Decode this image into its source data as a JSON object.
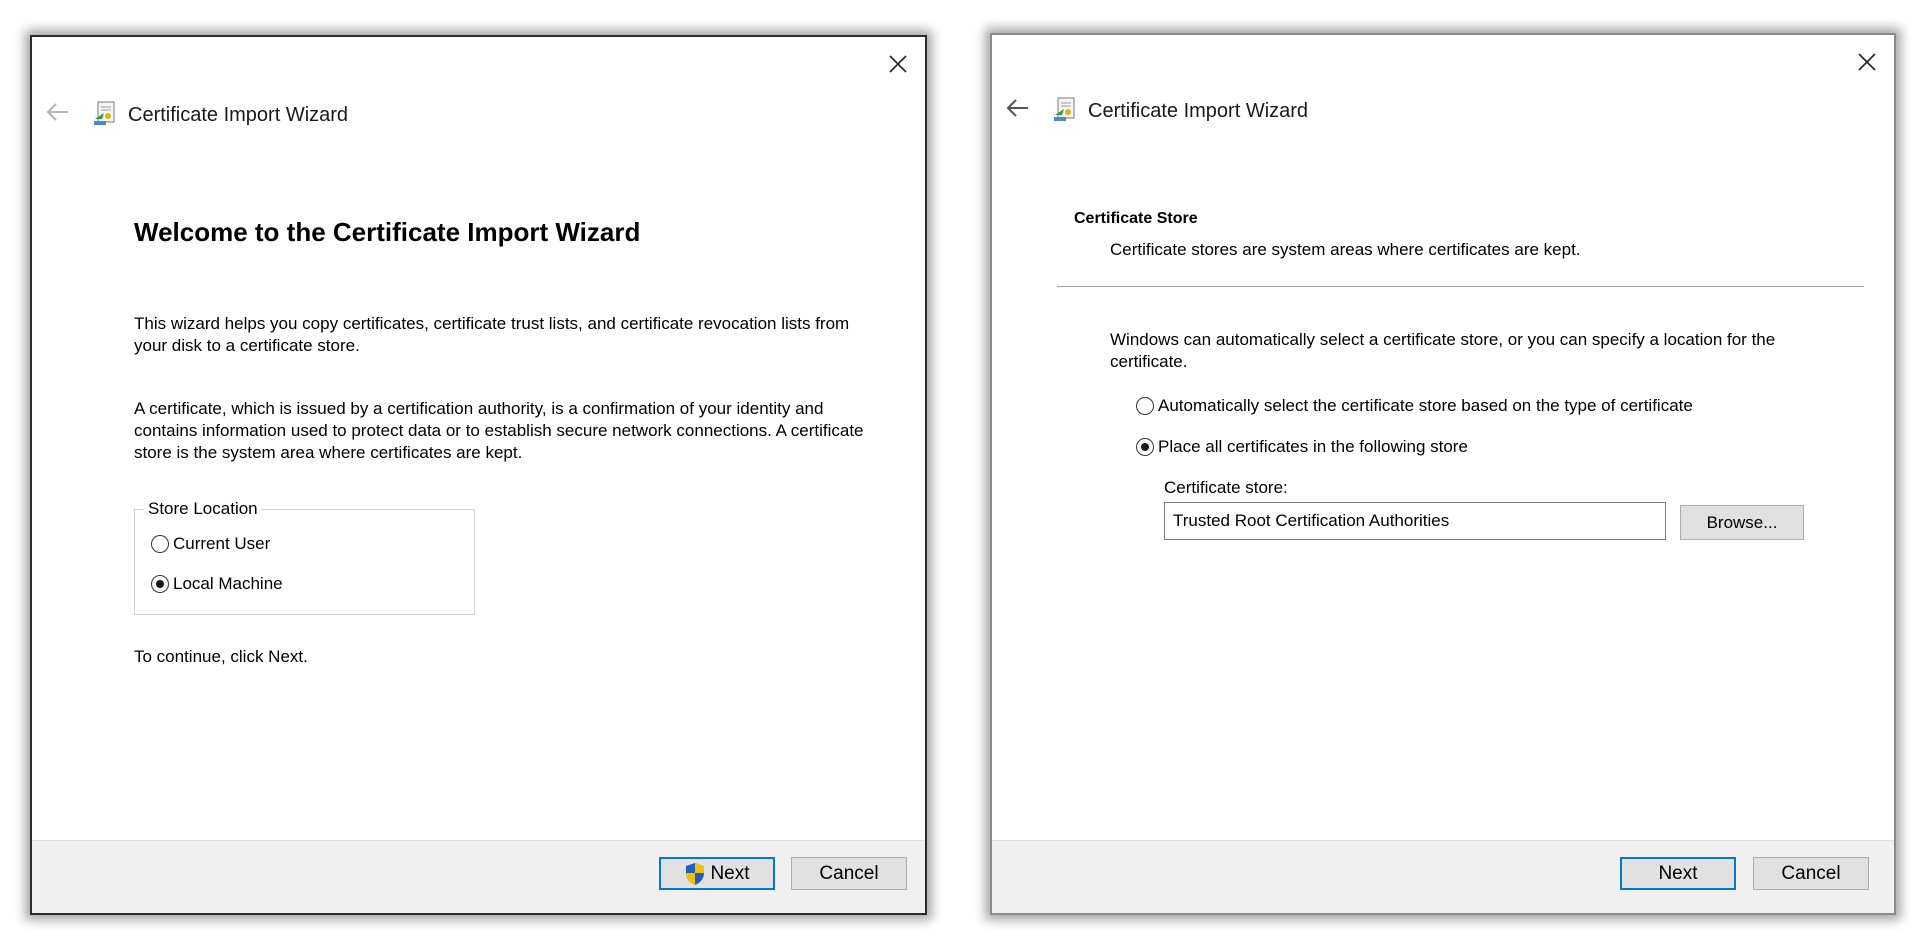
{
  "wizard1": {
    "title": "Certificate Import Wizard",
    "heading": "Welcome to the Certificate Import Wizard",
    "paragraph1": "This wizard helps you copy certificates, certificate trust lists, and certificate revocation lists from your disk to a certificate store.",
    "paragraph2": "A certificate, which is issued by a certification authority, is a confirmation of your identity and contains information used to protect data or to establish secure network connections. A certificate store is the system area where certificates are kept.",
    "store_location": {
      "legend": "Store Location",
      "options": [
        {
          "label": "Current User",
          "checked": false
        },
        {
          "label": "Local Machine",
          "checked": true
        }
      ]
    },
    "continue_text": "To continue, click Next.",
    "buttons": {
      "next": "Next",
      "cancel": "Cancel"
    }
  },
  "wizard2": {
    "title": "Certificate Import Wizard",
    "section_title": "Certificate Store",
    "section_subtitle": "Certificate stores are system areas where certificates are kept.",
    "paragraph": "Windows can automatically select a certificate store, or you can specify a location for the certificate.",
    "options": [
      {
        "label": "Automatically select the certificate store based on the type of certificate",
        "checked": false
      },
      {
        "label": "Place all certificates in the following store",
        "checked": true
      }
    ],
    "store_label": "Certificate store:",
    "store_value": "Trusted Root Certification Authorities",
    "browse_label": "Browse...",
    "buttons": {
      "next": "Next",
      "cancel": "Cancel"
    }
  },
  "colors": {
    "accent": "#0078d7",
    "footer_bg": "#f0f0f0",
    "button_bg": "#e1e1e1"
  },
  "icons": {
    "close": "close-icon",
    "back": "back-arrow-icon",
    "wizard": "certificate-wizard-icon",
    "uac": "uac-shield-icon"
  }
}
